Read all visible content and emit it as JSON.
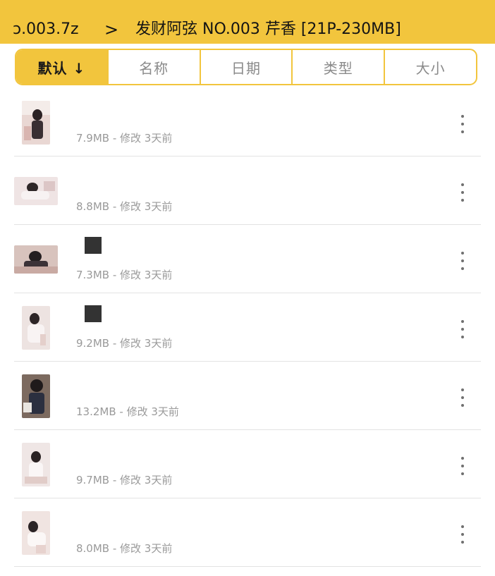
{
  "header": {
    "parent_folder": "ɔ.003.7z",
    "separator": ">",
    "current_folder": "发财阿弦 NO.003 芹香 [21P-230MB]"
  },
  "sort_tabs": [
    {
      "label": "默认 ↓",
      "active": true
    },
    {
      "label": "名称",
      "active": false
    },
    {
      "label": "日期",
      "active": false
    },
    {
      "label": "类型",
      "active": false
    },
    {
      "label": "大小",
      "active": false
    }
  ],
  "files": [
    {
      "meta": "7.9MB - 修改 3天前",
      "thumb": "portrait"
    },
    {
      "meta": "8.8MB - 修改 3天前",
      "thumb": "landscape"
    },
    {
      "meta": "7.3MB - 修改 3天前",
      "thumb": "landscape"
    },
    {
      "meta": "9.2MB - 修改 3天前",
      "thumb": "portrait"
    },
    {
      "meta": "13.2MB - 修改 3天前",
      "thumb": "portrait"
    },
    {
      "meta": "9.7MB - 修改 3天前",
      "thumb": "portrait"
    },
    {
      "meta": "8.0MB - 修改 3天前",
      "thumb": "portrait"
    }
  ],
  "colors": {
    "accent": "#f2c53d",
    "meta_text": "#9a9a9a"
  }
}
